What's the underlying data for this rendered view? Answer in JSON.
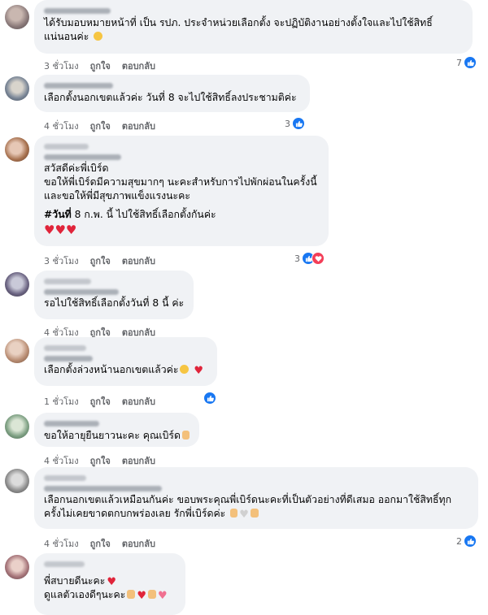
{
  "labels": {
    "like": "ถูกใจ",
    "reply": "ตอบกลับ"
  },
  "colors": {
    "like_blue": "#1877f2",
    "love_red": "#f33e58",
    "bubble_bg": "#f0f2f5",
    "meta_gray": "#65676b"
  },
  "comments": [
    {
      "lines": [
        "ได้รับมอบหมายหน้าที่ เป็น รปภ. ประจำหน่วยเลือกตั้ง จะปฏิบัติงานอย่างตั้งใจและไปใช้สิทธิ์",
        "แน่นอนค่ะ"
      ],
      "emoji": [
        "smiling-face"
      ],
      "time": "3 ชั่วโมง",
      "reaction_count": "7",
      "reactions": [
        "like"
      ]
    },
    {
      "lines": [
        "เลือกตั้งนอกเขตแล้วค่ะ วันที่ 8 จะไปใช้สิทธิ์ลงประชามติค่ะ"
      ],
      "time": "4 ชั่วโมง",
      "reaction_count": "3",
      "reactions": [
        "like"
      ]
    },
    {
      "lines": [
        "สวัสดีค่ะพี่เบิร์ด",
        "ขอให้พี่เบิร์ดมีความสุขมากๆ นะคะสำหรับการไปพักผ่อนในครั้งนี้",
        "และขอให้พี่มีสุขภาพแข็งแรงนะคะ"
      ],
      "hashtag": "#วันที่",
      "hashtag_rest": " 8 ก.พ. นี้ ไปใช้สิทธิ์เลือกตั้งกันค่ะ",
      "hearts": "♥♥♥",
      "time": "3 ชั่วโมง",
      "reaction_count": "3",
      "reactions": [
        "like",
        "love"
      ]
    },
    {
      "lines": [
        "รอไปใช้สิทธิ์เลือกตั้งวันที่ 8 นี้ ค่ะ"
      ],
      "time": "4 ชั่วโมง"
    },
    {
      "lines": [
        "เลือกตั้งล่วงหน้านอกเขตแล้วค่ะ"
      ],
      "emoji": [
        "smiling-hearts-face",
        "heart"
      ],
      "time": "1 ชั่วโมง",
      "reactions": [
        "like"
      ]
    },
    {
      "lines": [
        "ขอให้อายุยืนยาวนะคะ คุณเบิร์ด"
      ],
      "emoji": [
        "folded-hands"
      ],
      "time": "4 ชั่วโมง"
    },
    {
      "lines": [
        "เลือกนอกเขตแล้วเหมือนกันค่ะ ขอบพระคุณพี่เบิร์ดนะคะที่เป็นตัวอย่างที่ดีเสมอ ออกมาใช้สิทธิ์ทุก",
        "ครั้งไม่เคยขาดตกบกพร่องเลย รักพี่เบิร์ดค่ะ"
      ],
      "emoji": [
        "folded-hands",
        "white-heart",
        "thumbs-up"
      ],
      "time": "4 ชั่วโมง",
      "reaction_count": "2",
      "reactions": [
        "like"
      ]
    },
    {
      "lines": [
        "พี่สบายดีนะคะ",
        "ดูแลตัวเองดีๆนะคะ"
      ],
      "emoji": [
        "heart",
        "love-you-hand",
        "heart",
        "love-you-hand",
        "heart-ribbon"
      ]
    }
  ]
}
